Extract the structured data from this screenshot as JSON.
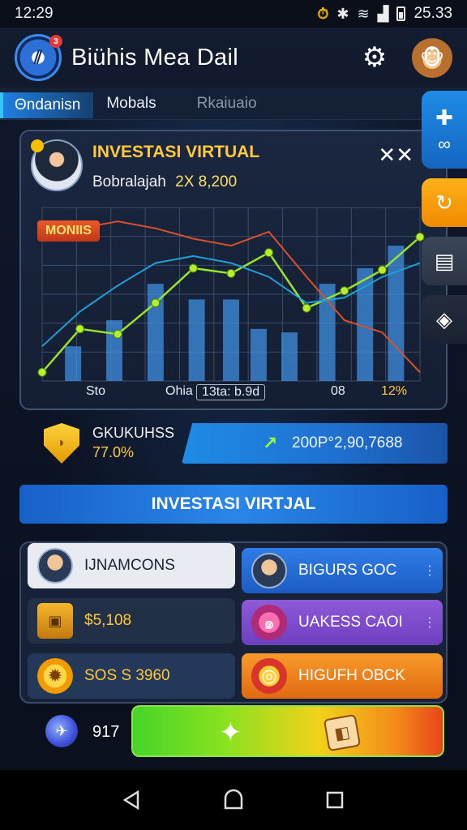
{
  "status_bar": {
    "time": "12:29",
    "battery_text": "25.33",
    "icons": [
      "alarm-icon",
      "bluetooth-icon",
      "wifi-icon",
      "signal-icon",
      "battery-icon"
    ]
  },
  "header": {
    "title": "Biühis Mea Dail",
    "logo_badge": "3"
  },
  "tabs": [
    {
      "label": "Θndanisn",
      "active": true
    },
    {
      "label": "Mobals",
      "active": false
    },
    {
      "label": "Rkaiuaio",
      "active": false
    }
  ],
  "chart_card": {
    "title": "INVESTASI VIRTUAL",
    "subtitle": "Bobralajah",
    "amount": "2X 8,200",
    "badge": "MONIIS",
    "close": "✕✕"
  },
  "chart_data": {
    "type": "bar",
    "categories": [
      "Sto",
      "",
      "",
      "Ohia",
      "",
      "",
      "",
      "",
      "08",
      "",
      "12%"
    ],
    "x_tick_labels": [
      {
        "text": "Sto",
        "style": "plain"
      },
      {
        "text": "Ohia",
        "style": "plain"
      },
      {
        "text": "13ta: b.9d",
        "style": "framed"
      },
      {
        "text": "08",
        "style": "plain"
      },
      {
        "text": "12%",
        "style": "yellow"
      }
    ],
    "series": [
      {
        "kind": "bar",
        "values": [
          20,
          35,
          56,
          47,
          47,
          30,
          28,
          56,
          65,
          78
        ],
        "color": "#3f8fe0"
      },
      {
        "kind": "line",
        "values": [
          5,
          30,
          27,
          45,
          65,
          62,
          74,
          42,
          52,
          64,
          83
        ],
        "color": "#9be22b"
      },
      {
        "kind": "line",
        "values": [
          90,
          88,
          92,
          88,
          82,
          78,
          86,
          60,
          35,
          28,
          5
        ],
        "color": "#d9502a"
      },
      {
        "kind": "line",
        "values": [
          20,
          40,
          55,
          68,
          72,
          68,
          60,
          45,
          48,
          60,
          68
        ],
        "color": "#1fa0d8"
      }
    ],
    "ylim": [
      0,
      100
    ],
    "grid": true
  },
  "balance": {
    "label": "GKUKUHSS",
    "percent": "77.0%",
    "value": "200P°2,90,7688"
  },
  "banner": {
    "label": "INVESTASI VIRTJAL"
  },
  "grid_cells": [
    {
      "label": "IJNAMCONS",
      "style": "white",
      "icon": "avatar-icon"
    },
    {
      "label": "BIGURS GOC",
      "style": "blue",
      "icon": "avatar-icon"
    },
    {
      "label": "$5,108",
      "style": "dark",
      "icon": "treasure-chest-icon"
    },
    {
      "label": "UAKESS CAOI",
      "style": "purple",
      "icon": "swirl-icon"
    },
    {
      "label": "SOS S 3960",
      "style": "darkblue",
      "icon": "sun-gear-icon"
    },
    {
      "label": "HIGUFH OBCK",
      "style": "orange",
      "icon": "ring-icon"
    }
  ],
  "bottom": {
    "count": "917"
  },
  "side_rail": [
    "add-icon",
    "refresh-icon",
    "chat-icon",
    "tag-icon"
  ],
  "colors": {
    "accent_blue": "#1e8ce6",
    "gold": "#ffc93b",
    "green": "#9be22b",
    "orange": "#f08a00"
  }
}
